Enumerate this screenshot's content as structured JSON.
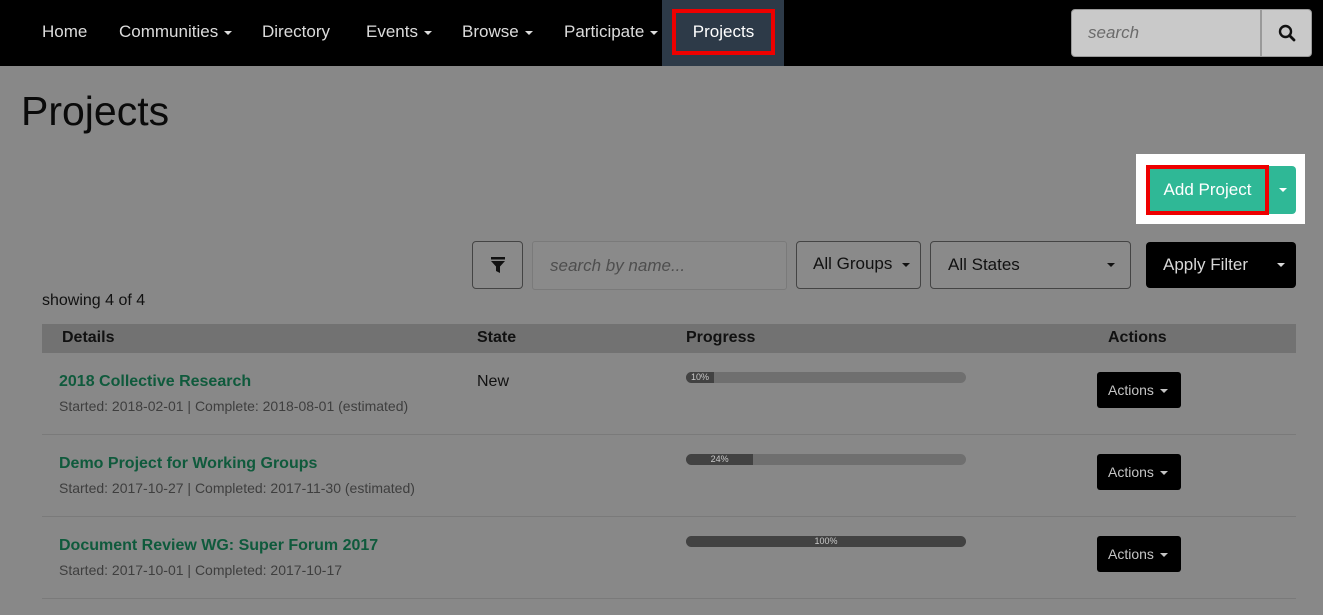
{
  "nav": {
    "items": [
      {
        "label": "Home",
        "has_caret": false
      },
      {
        "label": "Communities",
        "has_caret": true
      },
      {
        "label": "Directory",
        "has_caret": false
      },
      {
        "label": "Events",
        "has_caret": true
      },
      {
        "label": "Browse",
        "has_caret": true
      },
      {
        "label": "Participate",
        "has_caret": true
      }
    ],
    "active_label": "Projects",
    "search_placeholder": "search"
  },
  "page": {
    "title": "Projects",
    "add_project_label": "Add Project"
  },
  "filters": {
    "name_placeholder": "search by name...",
    "groups_value": "All Groups",
    "states_value": "All States",
    "apply_label": "Apply Filter"
  },
  "showing_text": "showing 4 of 4",
  "table": {
    "headers": {
      "details": "Details",
      "state": "State",
      "progress": "Progress",
      "actions": "Actions"
    },
    "rows": [
      {
        "title": "2018 Collective Research",
        "dates": "Started: 2018-02-01 | Complete: 2018-08-01 (estimated)",
        "state": "New",
        "progress": 10,
        "progress_label": "10%",
        "actions_label": "Actions"
      },
      {
        "title": "Demo Project for Working Groups",
        "dates": "Started: 2017-10-27 | Completed: 2017-11-30 (estimated)",
        "state": "",
        "progress": 24,
        "progress_label": "24%",
        "actions_label": "Actions"
      },
      {
        "title": "Document Review WG: Super Forum 2017",
        "dates": "Started: 2017-10-01 | Completed: 2017-10-17",
        "state": "",
        "progress": 100,
        "progress_label": "100%",
        "actions_label": "Actions"
      }
    ]
  },
  "colors": {
    "accent_green": "#2fb896",
    "highlight_red": "#ee0000",
    "link_green": "#0f5a3c"
  }
}
